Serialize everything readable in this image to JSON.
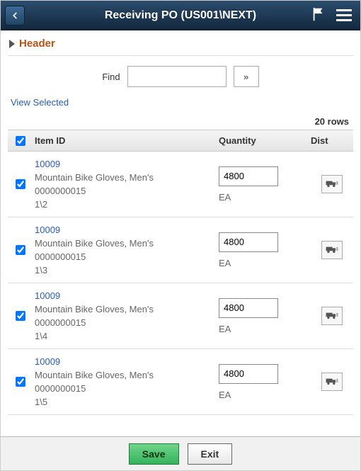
{
  "topbar": {
    "title": "Receiving PO (US001\\NEXT)"
  },
  "section": {
    "header_label": "Header"
  },
  "find": {
    "label": "Find",
    "value": "",
    "placeholder": ""
  },
  "view_selected_label": "View Selected",
  "row_count_label": "20 rows",
  "columns": {
    "item": "Item ID",
    "qty": "Quantity",
    "dist": "Dist"
  },
  "rows": [
    {
      "checked": true,
      "item_id": "10009",
      "desc": "Mountain Bike Gloves, Men's",
      "contract": "0000000015",
      "line": "1\\2",
      "qty": "4800",
      "uom": "EA"
    },
    {
      "checked": true,
      "item_id": "10009",
      "desc": "Mountain Bike Gloves, Men's",
      "contract": "0000000015",
      "line": "1\\3",
      "qty": "4800",
      "uom": "EA"
    },
    {
      "checked": true,
      "item_id": "10009",
      "desc": "Mountain Bike Gloves, Men's",
      "contract": "0000000015",
      "line": "1\\4",
      "qty": "4800",
      "uom": "EA"
    },
    {
      "checked": true,
      "item_id": "10009",
      "desc": "Mountain Bike Gloves, Men's",
      "contract": "0000000015",
      "line": "1\\5",
      "qty": "4800",
      "uom": "EA"
    }
  ],
  "buttons": {
    "save": "Save",
    "exit": "Exit"
  }
}
